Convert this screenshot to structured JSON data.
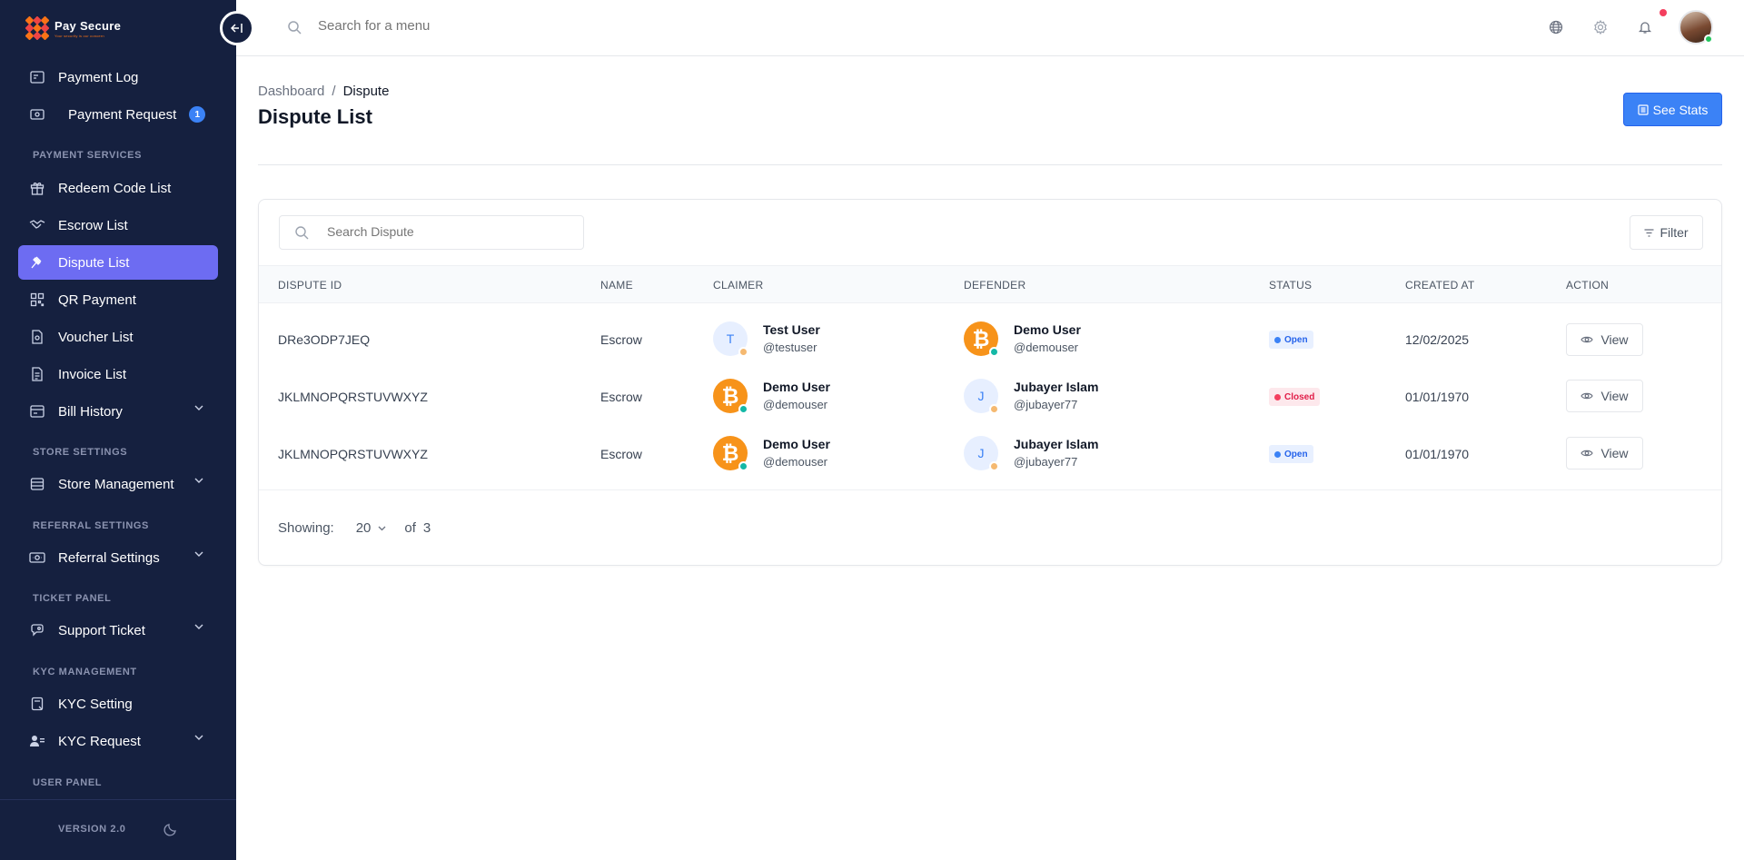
{
  "app": {
    "brand_name": "Pay Secure",
    "brand_tagline": "Your security is our concern",
    "version": "VERSION 2.0"
  },
  "sidebar": {
    "items_top": [
      {
        "label": "Payment Log",
        "icon": "payment-log-icon"
      },
      {
        "label": "Payment Request",
        "icon": "payment-request-icon",
        "badge": "1"
      }
    ],
    "sections": [
      {
        "title": "PAYMENT SERVICES"
      },
      {
        "title": "STORE SETTINGS"
      },
      {
        "title": "REFERRAL SETTINGS"
      },
      {
        "title": "TICKET PANEL"
      },
      {
        "title": "KYC MANAGEMENT"
      },
      {
        "title": "USER PANEL"
      }
    ],
    "items": [
      {
        "label": "Redeem Code List",
        "icon": "gift-icon"
      },
      {
        "label": "Escrow List",
        "icon": "handshake-icon"
      },
      {
        "label": "Dispute List",
        "icon": "gavel-icon",
        "active": true
      },
      {
        "label": "QR Payment",
        "icon": "qr-icon"
      },
      {
        "label": "Voucher List",
        "icon": "voucher-icon"
      },
      {
        "label": "Invoice List",
        "icon": "invoice-icon"
      },
      {
        "label": "Bill History",
        "icon": "bill-icon"
      },
      {
        "label": "Store Management",
        "icon": "store-icon"
      },
      {
        "label": "Referral Settings",
        "icon": "referral-icon"
      },
      {
        "label": "Support Ticket",
        "icon": "support-icon"
      },
      {
        "label": "KYC Setting",
        "icon": "kyc-setting-icon"
      },
      {
        "label": "KYC Request",
        "icon": "kyc-request-icon"
      }
    ]
  },
  "topbar": {
    "search_placeholder": "Search for a menu"
  },
  "header": {
    "breadcrumb_root": "Dashboard",
    "breadcrumb_sep": "/",
    "breadcrumb_current": "Dispute",
    "title": "Dispute List",
    "stats_button": "See Stats"
  },
  "table": {
    "search_placeholder": "Search Dispute",
    "filter_label": "Filter",
    "columns": [
      "DISPUTE ID",
      "NAME",
      "CLAIMER",
      "DEFENDER",
      "STATUS",
      "CREATED AT",
      "ACTION"
    ],
    "rows": [
      {
        "dispute_id": "DRe3ODP7JEQ",
        "name": "Escrow",
        "claimer": {
          "initial": "T",
          "name": "Test User",
          "handle": "@testuser"
        },
        "defender": {
          "name": "Demo User",
          "handle": "@demouser"
        },
        "status": "Open",
        "created_at": "12/02/2025",
        "action": "View"
      },
      {
        "dispute_id": "JKLMNOPQRSTUVWXYZ",
        "name": "Escrow",
        "claimer": {
          "name": "Demo User",
          "handle": "@demouser"
        },
        "defender": {
          "initial": "J",
          "name": "Jubayer Islam",
          "handle": "@jubayer77"
        },
        "status": "Closed",
        "created_at": "01/01/1970",
        "action": "View"
      },
      {
        "dispute_id": "JKLMNOPQRSTUVWXYZ",
        "name": "Escrow",
        "claimer": {
          "name": "Demo User",
          "handle": "@demouser"
        },
        "defender": {
          "initial": "J",
          "name": "Jubayer Islam",
          "handle": "@jubayer77"
        },
        "status": "Open",
        "created_at": "01/01/1970",
        "action": "View"
      }
    ],
    "footer": {
      "showing_label": "Showing:",
      "per_page": "20",
      "of_label": "of",
      "total": "3"
    }
  },
  "colors": {
    "sidebar_bg": "#15203f",
    "active_item": "#6d6cf2",
    "primary": "#3b82f6",
    "open_status": "#3b82f6",
    "closed_status": "#f43f5e"
  }
}
